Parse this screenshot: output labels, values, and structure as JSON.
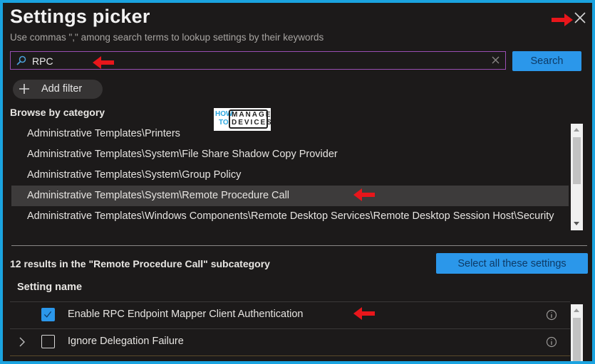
{
  "header": {
    "title": "Settings picker",
    "subtitle": "Use commas \",\" among search terms to lookup settings by their keywords"
  },
  "search": {
    "value": "RPC",
    "button_label": "Search"
  },
  "filter": {
    "add_label": "Add filter"
  },
  "browse": {
    "heading": "Browse by category",
    "categories": [
      {
        "label": "Administrative Templates\\Printers",
        "selected": false
      },
      {
        "label": "Administrative Templates\\System\\File Share Shadow Copy Provider",
        "selected": false
      },
      {
        "label": "Administrative Templates\\System\\Group Policy",
        "selected": false
      },
      {
        "label": "Administrative Templates\\System\\Remote Procedure Call",
        "selected": true
      },
      {
        "label": "Administrative Templates\\Windows Components\\Remote Desktop Services\\Remote Desktop Session Host\\Security",
        "selected": false
      }
    ]
  },
  "watermark": {
    "line1a": "HOW",
    "line1b": "TO",
    "md1": "MANAGE",
    "md2": "DEVICES"
  },
  "results": {
    "summary": "12 results in the \"Remote Procedure Call\" subcategory",
    "select_all_label": "Select all these settings",
    "column_header": "Setting name",
    "rows": [
      {
        "name": "Enable RPC Endpoint Mapper Client Authentication",
        "checked": true,
        "expandable": false
      },
      {
        "name": "Ignore Delegation Failure",
        "checked": false,
        "expandable": true
      }
    ]
  },
  "colors": {
    "accent": "#2b97ea",
    "search_border": "#9a4fb3",
    "annotation_arrow": "#e8161b",
    "frame": "#1aa3e0"
  }
}
